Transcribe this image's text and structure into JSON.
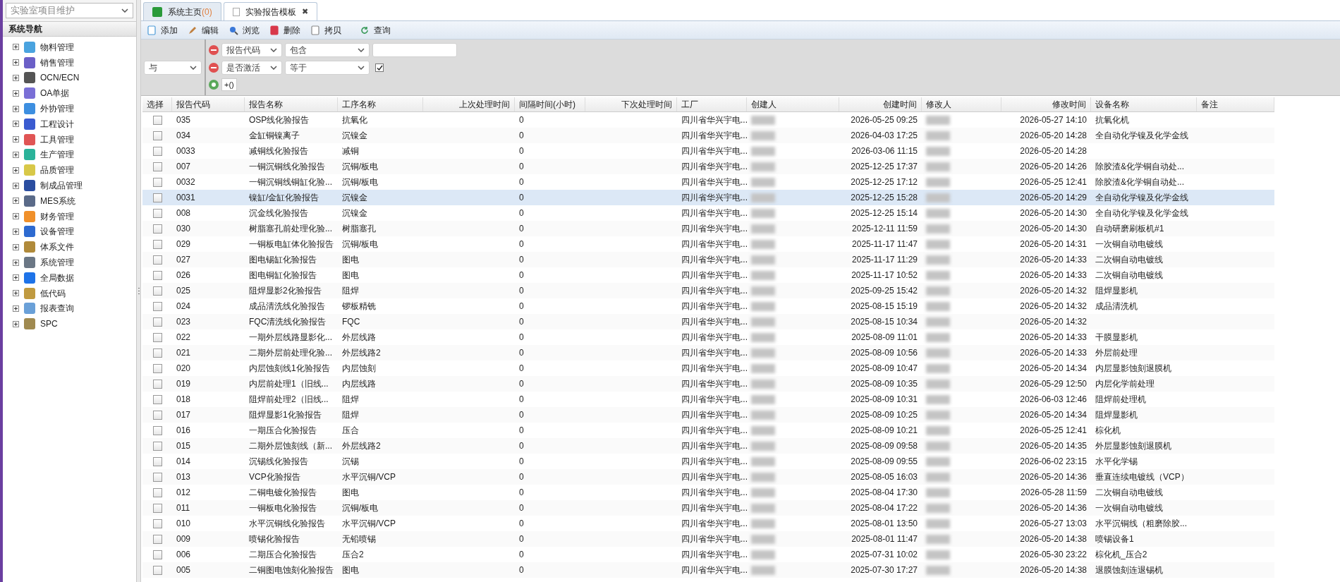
{
  "module_select": {
    "value": "实验室项目维护"
  },
  "sidebar": {
    "title": "系统导航",
    "items": [
      {
        "label": "物料管理",
        "expanded": false
      },
      {
        "label": "销售管理",
        "expanded": false
      },
      {
        "label": "OCN/ECN",
        "expanded": false
      },
      {
        "label": "OA单据",
        "expanded": false
      },
      {
        "label": "外协管理",
        "expanded": false
      },
      {
        "label": "工程设计",
        "expanded": false
      },
      {
        "label": "工具管理",
        "expanded": false
      },
      {
        "label": "生产管理",
        "expanded": false
      },
      {
        "label": "品质管理",
        "expanded": false
      },
      {
        "label": "制成品管理",
        "expanded": false
      },
      {
        "label": "MES系统",
        "expanded": false
      },
      {
        "label": "财务管理",
        "expanded": false
      },
      {
        "label": "设备管理",
        "expanded": false
      },
      {
        "label": "体系文件",
        "expanded": false
      },
      {
        "label": "系统管理",
        "expanded": false
      },
      {
        "label": "全局数据",
        "expanded": false
      },
      {
        "label": "低代码",
        "expanded": false
      },
      {
        "label": "报表查询",
        "expanded": false
      },
      {
        "label": "SPC",
        "expanded": false
      }
    ]
  },
  "tabs": [
    {
      "label": "系统主页",
      "badge": "(0)",
      "selected": false
    },
    {
      "label": "实验报告模板",
      "selected": true,
      "close": "✖"
    }
  ],
  "toolbar": [
    "添加",
    "编辑",
    "浏览",
    "删除",
    "拷贝",
    "查询"
  ],
  "filter": {
    "logic": "与",
    "conditions": [
      {
        "kind": "text",
        "field": "报告代码",
        "operator": "包含"
      },
      {
        "kind": "checkbox",
        "field": "是否激活",
        "operator": "等于",
        "checked": true
      }
    ],
    "group_button": "+()"
  },
  "table": {
    "columns": [
      "选择",
      "报告代码",
      "报告名称",
      "工序名称",
      "上次处理时间",
      "间隔时间(小时)",
      "下次处理时间",
      "工厂",
      "创建人",
      "创建时间",
      "修改人",
      "修改时间",
      "设备名称",
      "备注"
    ],
    "rows": [
      {
        "checked": false,
        "selected": false,
        "code": "035",
        "name": "OSP线化验报告",
        "process": "抗氧化",
        "interval": "0",
        "factory": "四川省华兴宇电...",
        "created": "2026-05-25 09:25",
        "modified": "2026-05-27 14:10",
        "equipment": "抗氧化机"
      },
      {
        "checked": false,
        "selected": false,
        "code": "034",
        "name": "金缸铜镍离子",
        "process": "沉镍金",
        "interval": "0",
        "factory": "四川省华兴宇电...",
        "created": "2026-04-03 17:25",
        "modified": "2026-05-20 14:28",
        "equipment": "全自动化学镍及化学金线"
      },
      {
        "checked": false,
        "selected": false,
        "code": "0033",
        "name": "减铜线化验报告",
        "process": "减铜",
        "interval": "0",
        "factory": "四川省华兴宇电...",
        "created": "2026-03-06 11:15",
        "modified": "2026-05-20 14:28"
      },
      {
        "checked": false,
        "selected": false,
        "code": "007",
        "name": "一铜沉铜线化验报告",
        "process": "沉铜/板电",
        "interval": "0",
        "factory": "四川省华兴宇电...",
        "created": "2025-12-25 17:37",
        "modified": "2026-05-20 14:26",
        "equipment": "除胶渣&化学铜自动处..."
      },
      {
        "checked": false,
        "selected": false,
        "code": "0032",
        "name": "一铜沉铜线铜缸化验...",
        "process": "沉铜/板电",
        "interval": "0",
        "factory": "四川省华兴宇电...",
        "created": "2025-12-25 17:12",
        "modified": "2026-05-25 12:41",
        "equipment": "除胶渣&化学铜自动处..."
      },
      {
        "checked": false,
        "selected": true,
        "code": "0031",
        "name": "镍缸/金缸化验报告",
        "process": "沉镍金",
        "interval": "0",
        "factory": "四川省华兴宇电...",
        "created": "2025-12-25 15:28",
        "modified": "2026-05-20 14:29",
        "equipment": "全自动化学镍及化学金线"
      },
      {
        "checked": false,
        "selected": false,
        "code": "008",
        "name": "沉金线化验报告",
        "process": "沉镍金",
        "interval": "0",
        "factory": "四川省华兴宇电...",
        "created": "2025-12-25 15:14",
        "modified": "2026-05-20 14:30",
        "equipment": "全自动化学镍及化学金线"
      },
      {
        "checked": false,
        "selected": false,
        "code": "030",
        "name": "树脂塞孔前处理化验...",
        "process": "树脂塞孔",
        "interval": "0",
        "factory": "四川省华兴宇电...",
        "created": "2025-12-11 11:59",
        "modified": "2026-05-20 14:30",
        "equipment": "自动研磨刷板机#1"
      },
      {
        "checked": false,
        "selected": false,
        "code": "029",
        "name": "一铜板电缸体化验报告",
        "process": "沉铜/板电",
        "interval": "0",
        "factory": "四川省华兴宇电...",
        "created": "2025-11-17 11:47",
        "modified": "2026-05-20 14:31",
        "equipment": "一次铜自动电镀线"
      },
      {
        "checked": false,
        "selected": false,
        "code": "027",
        "name": "图电锡缸化验报告",
        "process": "图电",
        "interval": "0",
        "factory": "四川省华兴宇电...",
        "created": "2025-11-17 11:29",
        "modified": "2026-05-20 14:33",
        "equipment": "二次铜自动电镀线"
      },
      {
        "checked": false,
        "selected": false,
        "code": "026",
        "name": "图电铜缸化验报告",
        "process": "图电",
        "interval": "0",
        "factory": "四川省华兴宇电...",
        "created": "2025-11-17 10:52",
        "modified": "2026-05-20 14:33",
        "equipment": "二次铜自动电镀线"
      },
      {
        "checked": false,
        "selected": false,
        "code": "025",
        "name": "阻焊显影2化验报告",
        "process": "阻焊",
        "interval": "0",
        "factory": "四川省华兴宇电...",
        "created": "2025-09-25 15:42",
        "modified": "2026-05-20 14:32",
        "equipment": "阻焊显影机"
      },
      {
        "checked": false,
        "selected": false,
        "code": "024",
        "name": "成品清洗线化验报告",
        "process": "锣板精铣",
        "interval": "0",
        "factory": "四川省华兴宇电...",
        "created": "2025-08-15 15:19",
        "modified": "2026-05-20 14:32",
        "equipment": "成品清洗机"
      },
      {
        "checked": false,
        "selected": false,
        "code": "023",
        "name": "FQC清洗线化验报告",
        "process": "FQC",
        "interval": "0",
        "factory": "四川省华兴宇电...",
        "created": "2025-08-15 10:34",
        "modified": "2026-05-20 14:32"
      },
      {
        "checked": false,
        "selected": false,
        "code": "022",
        "name": "一期外层线路显影化...",
        "process": "外层线路",
        "interval": "0",
        "factory": "四川省华兴宇电...",
        "created": "2025-08-09 11:01",
        "modified": "2026-05-20 14:33",
        "equipment": "干膜显影机"
      },
      {
        "checked": false,
        "selected": false,
        "code": "021",
        "name": "二期外层前处理化验...",
        "process": "外层线路2",
        "interval": "0",
        "factory": "四川省华兴宇电...",
        "created": "2025-08-09 10:56",
        "modified": "2026-05-20 14:33",
        "equipment": "外层前处理"
      },
      {
        "checked": false,
        "selected": false,
        "code": "020",
        "name": "内层蚀刻线1化验报告",
        "process": "内层蚀刻",
        "interval": "0",
        "factory": "四川省华兴宇电...",
        "created": "2025-08-09 10:47",
        "modified": "2026-05-20 14:34",
        "equipment": "内层显影蚀刻退膜机"
      },
      {
        "checked": false,
        "selected": false,
        "code": "019",
        "name": "内层前处理1（旧线...",
        "process": "内层线路",
        "interval": "0",
        "factory": "四川省华兴宇电...",
        "created": "2025-08-09 10:35",
        "modified": "2026-05-29 12:50",
        "equipment": "内层化学前处理"
      },
      {
        "checked": false,
        "selected": false,
        "code": "018",
        "name": "阻焊前处理2（旧线...",
        "process": "阻焊",
        "interval": "0",
        "factory": "四川省华兴宇电...",
        "created": "2025-08-09 10:31",
        "modified": "2026-06-03 12:46",
        "equipment": "阻焊前处理机"
      },
      {
        "checked": false,
        "selected": false,
        "code": "017",
        "name": "阻焊显影1化验报告",
        "process": "阻焊",
        "interval": "0",
        "factory": "四川省华兴宇电...",
        "created": "2025-08-09 10:25",
        "modified": "2026-05-20 14:34",
        "equipment": "阻焊显影机"
      },
      {
        "checked": false,
        "selected": false,
        "code": "016",
        "name": "一期压合化验报告",
        "process": "压合",
        "interval": "0",
        "factory": "四川省华兴宇电...",
        "created": "2025-08-09 10:21",
        "modified": "2026-05-25 12:41",
        "equipment": "棕化机"
      },
      {
        "checked": false,
        "selected": false,
        "code": "015",
        "name": "二期外层蚀刻线（新...",
        "process": "外层线路2",
        "interval": "0",
        "factory": "四川省华兴宇电...",
        "created": "2025-08-09 09:58",
        "modified": "2026-05-20 14:35",
        "equipment": "外层显影蚀刻退膜机"
      },
      {
        "checked": false,
        "selected": false,
        "code": "014",
        "name": "沉锡线化验报告",
        "process": "沉锡",
        "interval": "0",
        "factory": "四川省华兴宇电...",
        "created": "2025-08-09 09:55",
        "modified": "2026-06-02 23:15",
        "equipment": "水平化学锡"
      },
      {
        "checked": false,
        "selected": false,
        "code": "013",
        "name": "VCP化验报告",
        "process": "水平沉铜/VCP",
        "interval": "0",
        "factory": "四川省华兴宇电...",
        "created": "2025-08-05 16:03",
        "modified": "2026-05-20 14:36",
        "equipment": "垂直连续电镀线（VCP）"
      },
      {
        "checked": false,
        "selected": false,
        "code": "012",
        "name": "二铜电镀化验报告",
        "process": "图电",
        "interval": "0",
        "factory": "四川省华兴宇电...",
        "created": "2025-08-04 17:30",
        "modified": "2026-05-28 11:59",
        "equipment": "二次铜自动电镀线"
      },
      {
        "checked": false,
        "selected": false,
        "code": "011",
        "name": "一铜板电化验报告",
        "process": "沉铜/板电",
        "interval": "0",
        "factory": "四川省华兴宇电...",
        "created": "2025-08-04 17:22",
        "modified": "2026-05-20 14:36",
        "equipment": "一次铜自动电镀线"
      },
      {
        "checked": false,
        "selected": false,
        "code": "010",
        "name": "水平沉铜线化验报告",
        "process": "水平沉铜/VCP",
        "interval": "0",
        "factory": "四川省华兴宇电...",
        "created": "2025-08-01 13:50",
        "modified": "2026-05-27 13:03",
        "equipment": "水平沉铜线（粗磨除胶..."
      },
      {
        "checked": false,
        "selected": false,
        "code": "009",
        "name": "喷锡化验报告",
        "process": "无铅喷锡",
        "interval": "0",
        "factory": "四川省华兴宇电...",
        "created": "2025-08-01 11:47",
        "modified": "2026-05-20 14:38",
        "equipment": "喷锡设备1"
      },
      {
        "checked": false,
        "selected": false,
        "code": "006",
        "name": "二期压合化验报告",
        "process": "压合2",
        "interval": "0",
        "factory": "四川省华兴宇电...",
        "created": "2025-07-31 10:02",
        "modified": "2026-05-30 23:22",
        "equipment": "棕化机_压合2"
      },
      {
        "checked": false,
        "selected": false,
        "code": "005",
        "name": "二铜图电蚀刻化验报告",
        "process": "图电",
        "interval": "0",
        "factory": "四川省华兴宇电...",
        "created": "2025-07-30 17:27",
        "modified": "2026-05-20 14:38",
        "equipment": "退膜蚀刻连退锡机"
      }
    ]
  }
}
